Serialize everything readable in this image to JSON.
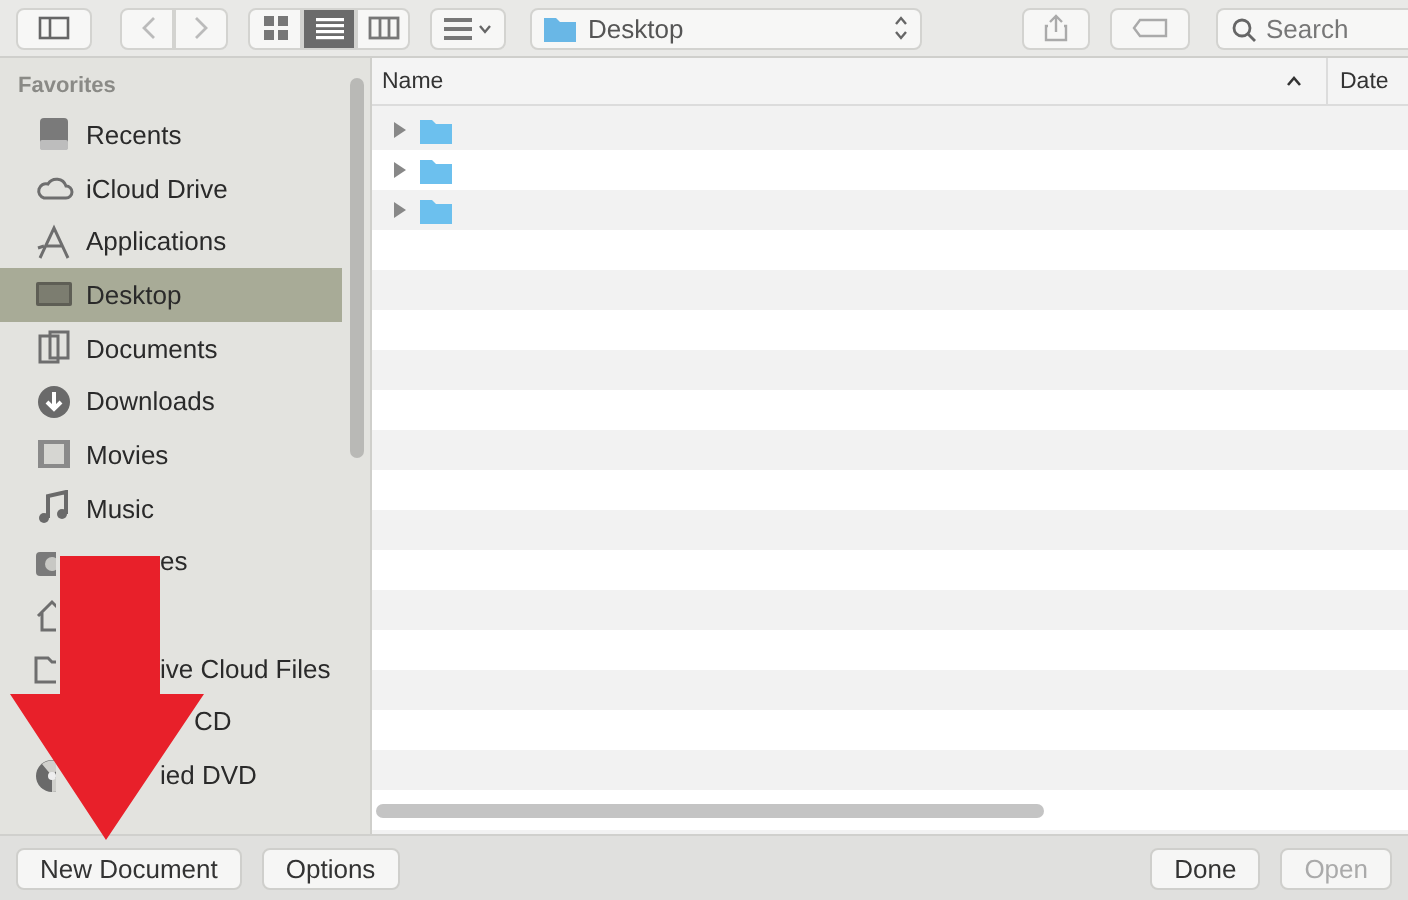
{
  "toolbar": {
    "views": [
      {
        "kind": "icons",
        "selected": false
      },
      {
        "kind": "list",
        "selected": true
      },
      {
        "kind": "columns",
        "selected": false
      }
    ],
    "location": "Desktop",
    "search": {
      "placeholder": "Search"
    }
  },
  "sidebar": {
    "heading": "Favorites",
    "items": [
      {
        "label": "Recents",
        "kind": "full",
        "selected": false
      },
      {
        "label": "iCloud Drive",
        "kind": "full",
        "selected": false
      },
      {
        "label": "Applications",
        "kind": "full",
        "selected": false
      },
      {
        "label": "Desktop",
        "kind": "full",
        "selected": true
      },
      {
        "label": "Documents",
        "kind": "full",
        "selected": false
      },
      {
        "label": "Downloads",
        "kind": "full",
        "selected": false
      },
      {
        "label": "Movies",
        "kind": "full",
        "selected": false
      },
      {
        "label": "Music",
        "kind": "full",
        "selected": false
      },
      {
        "label": "es",
        "kind": "covered",
        "selected": false
      },
      {
        "kind": "icon_only",
        "selected": false
      },
      {
        "label": "ive Cloud Files",
        "kind": "covered",
        "selected": false
      },
      {
        "label": "CD",
        "kind": "covered_more",
        "selected": false
      },
      {
        "label": "ied DVD",
        "kind": "covered",
        "selected": false
      }
    ]
  },
  "table": {
    "columns": [
      "Name",
      "Date"
    ],
    "rows": [
      {
        "expanded": false
      },
      {
        "expanded": false
      },
      {
        "expanded": false
      }
    ]
  },
  "buttons_left": [
    "New Document",
    "Options"
  ],
  "buttons_right": [
    {
      "label": "Done",
      "disabled": false
    },
    {
      "label": "Open",
      "disabled": true
    }
  ]
}
